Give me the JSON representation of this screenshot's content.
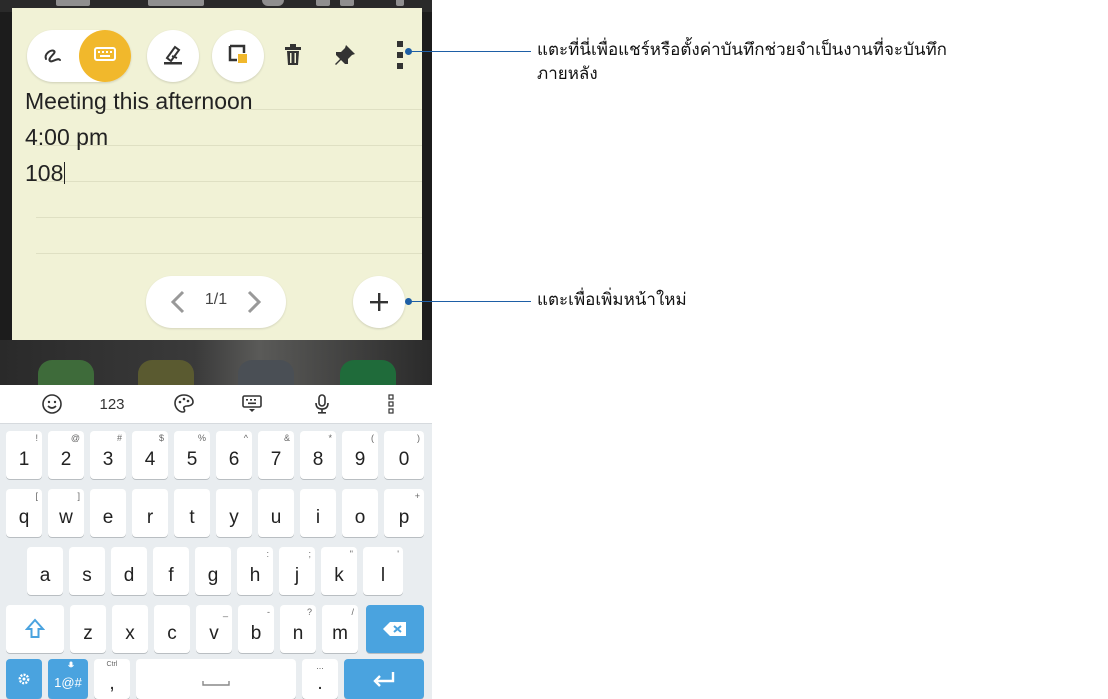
{
  "note": {
    "toolbar": {
      "handwriting_icon": "handwriting-icon",
      "keyboard_icon": "keyboard-icon",
      "highlighter_icon": "highlighter-icon",
      "paper_color_icon": "paper-color-icon",
      "delete_icon": "trash-icon",
      "pin_icon": "pin-icon",
      "more_icon": "more-vert-icon"
    },
    "lines": [
      "Meeting this afternoon",
      "4:00 pm",
      "108"
    ],
    "pager": {
      "label": "1/1"
    },
    "colors": {
      "paper": "#f1f2d6",
      "active": "#f1b82c"
    }
  },
  "keyboard": {
    "suggestions": {
      "numbers_label": "123"
    },
    "rows": [
      [
        {
          "main": "1",
          "sub": "!"
        },
        {
          "main": "2",
          "sub": "@"
        },
        {
          "main": "3",
          "sub": "#"
        },
        {
          "main": "4",
          "sub": "$"
        },
        {
          "main": "5",
          "sub": "%"
        },
        {
          "main": "6",
          "sub": "^"
        },
        {
          "main": "7",
          "sub": "&"
        },
        {
          "main": "8",
          "sub": "*"
        },
        {
          "main": "9",
          "sub": "("
        },
        {
          "main": "0",
          "sub": ")"
        }
      ],
      [
        {
          "main": "q",
          "sub": "["
        },
        {
          "main": "w",
          "sub": "]"
        },
        {
          "main": "e",
          "sub": ""
        },
        {
          "main": "r",
          "sub": ""
        },
        {
          "main": "t",
          "sub": ""
        },
        {
          "main": "y",
          "sub": ""
        },
        {
          "main": "u",
          "sub": ""
        },
        {
          "main": "i",
          "sub": ""
        },
        {
          "main": "o",
          "sub": ""
        },
        {
          "main": "p",
          "sub": "+"
        }
      ],
      [
        {
          "main": "a",
          "sub": ""
        },
        {
          "main": "s",
          "sub": ""
        },
        {
          "main": "d",
          "sub": ""
        },
        {
          "main": "f",
          "sub": ""
        },
        {
          "main": "g",
          "sub": ""
        },
        {
          "main": "h",
          "sub": ":"
        },
        {
          "main": "j",
          "sub": ";"
        },
        {
          "main": "k",
          "sub": "\""
        },
        {
          "main": "l",
          "sub": "'"
        }
      ],
      [
        {
          "main": "z",
          "sub": ""
        },
        {
          "main": "x",
          "sub": ""
        },
        {
          "main": "c",
          "sub": ""
        },
        {
          "main": "v",
          "sub": "_"
        },
        {
          "main": "b",
          "sub": "-"
        },
        {
          "main": "n",
          "sub": "?"
        },
        {
          "main": "m",
          "sub": "/"
        }
      ]
    ],
    "bottom": {
      "symbols_label": "1@#",
      "comma_label": ",",
      "comma_hint": "Ctrl",
      "period_label": ".",
      "period_hint": "..."
    },
    "colors": {
      "accent": "#4aa3df",
      "background": "#e9edf0"
    }
  },
  "callouts": {
    "more_options": {
      "line1": "แตะที่นี่เพื่อแชร์หรือตั้งค่าบันทึกช่วยจำเป็นงานที่จะบันทึก",
      "line2": "ภายหลัง"
    },
    "new_page": {
      "text": "แตะเพื่อเพิ่มหน้าใหม่"
    },
    "color": "#1e5fa6"
  }
}
